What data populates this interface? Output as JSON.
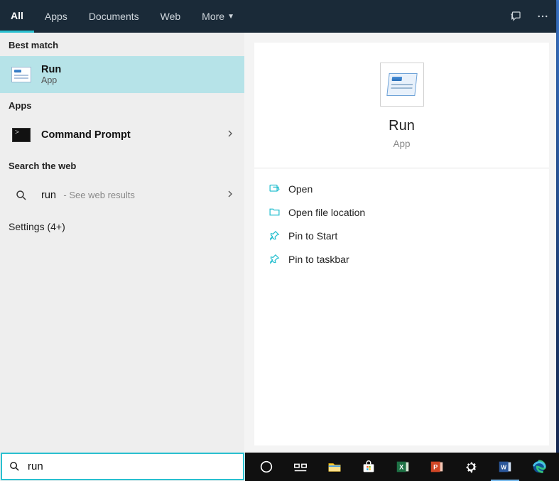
{
  "tabs": {
    "all": "All",
    "apps": "Apps",
    "documents": "Documents",
    "web": "Web",
    "more": "More"
  },
  "sections": {
    "best_match": "Best match",
    "apps": "Apps",
    "search_web": "Search the web",
    "settings": "Settings (4+)"
  },
  "best_match": {
    "title": "Run",
    "subtitle": "App"
  },
  "apps_results": [
    {
      "title": "Command Prompt"
    }
  ],
  "web_result": {
    "query": "run",
    "suffix": "- See web results"
  },
  "preview": {
    "title": "Run",
    "subtitle": "App",
    "actions": {
      "open": "Open",
      "open_loc": "Open file location",
      "pin_start": "Pin to Start",
      "pin_taskbar": "Pin to taskbar"
    }
  },
  "search": {
    "value": "run"
  }
}
